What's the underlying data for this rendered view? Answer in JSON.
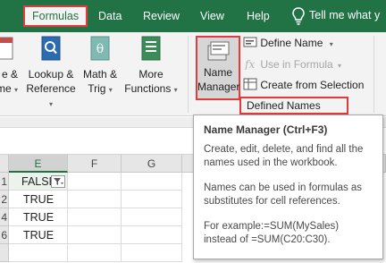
{
  "tabs": [
    {
      "label": "Formulas",
      "active": true
    },
    {
      "label": "Data",
      "active": false
    },
    {
      "label": "Review",
      "active": false
    },
    {
      "label": "View",
      "active": false
    },
    {
      "label": "Help",
      "active": false
    }
  ],
  "tell_me": "Tell me what y",
  "ribbon": {
    "date_time": {
      "line1": "e &",
      "line2": "me"
    },
    "lookup": {
      "line1": "Lookup &",
      "line2": "Reference"
    },
    "math": {
      "line1": "Math &",
      "line2": "Trig"
    },
    "more": {
      "line1": "More",
      "line2": "Functions"
    },
    "name_manager": {
      "line1": "Name",
      "line2": "Manager"
    },
    "define_name": "Define Name",
    "use_in_formula": "Use in Formula",
    "create_from_selection": "Create from Selection",
    "defined_names_group": "Defined Names"
  },
  "grid": {
    "columns": [
      "E",
      "F",
      "G"
    ],
    "rows": [
      {
        "num": "1",
        "E": "FALSE"
      },
      {
        "num": "2",
        "E": "TRUE"
      },
      {
        "num": "4",
        "E": "TRUE"
      },
      {
        "num": "6",
        "E": "TRUE"
      }
    ]
  },
  "tooltip": {
    "title": "Name Manager (Ctrl+F3)",
    "p1": "Create, edit, delete, and find all the names used in the workbook.",
    "p2": "Names can be used in formulas as substitutes for cell references.",
    "p3a": "For example:=SUM(MySales)",
    "p3b": "instead of =SUM(C20:C30)."
  },
  "colors": {
    "excel_green": "#217346",
    "highlight_red": "#e23b3b"
  }
}
